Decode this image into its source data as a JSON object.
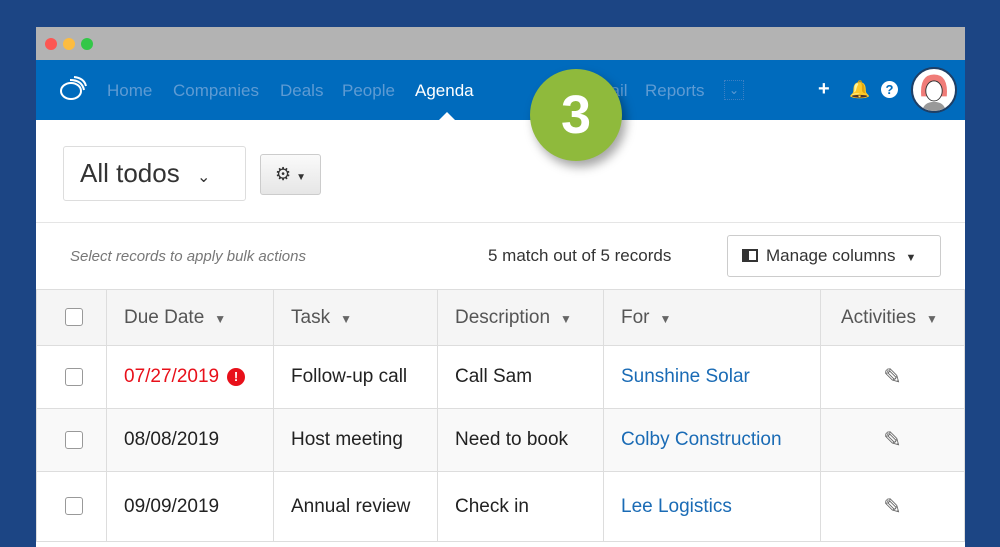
{
  "colors": {
    "nav": "#006bbd",
    "badge": "#8fba3c",
    "overdue": "#e8101a",
    "link": "#1a6bb5"
  },
  "nav": {
    "items": [
      "Home",
      "Companies",
      "Deals",
      "People",
      "Agenda",
      "Email",
      "Reports"
    ],
    "active": "Agenda"
  },
  "badge": "3",
  "view_select": "All todos",
  "bulk_hint": "Select records to apply bulk actions",
  "match_text": "5 match out of 5 records",
  "manage_columns": "Manage columns",
  "columns": [
    "Due Date",
    "Task",
    "Description",
    "For",
    "Activities"
  ],
  "rows": [
    {
      "due": "07/27/2019",
      "overdue": true,
      "task": "Follow-up call",
      "description": "Call Sam",
      "for": "Sunshine Solar"
    },
    {
      "due": "08/08/2019",
      "overdue": false,
      "task": "Host meeting",
      "description": "Need to book",
      "for": "Colby Construction"
    },
    {
      "due": "09/09/2019",
      "overdue": false,
      "task": "Annual review",
      "description": "Check in",
      "for": "Lee Logistics"
    }
  ]
}
